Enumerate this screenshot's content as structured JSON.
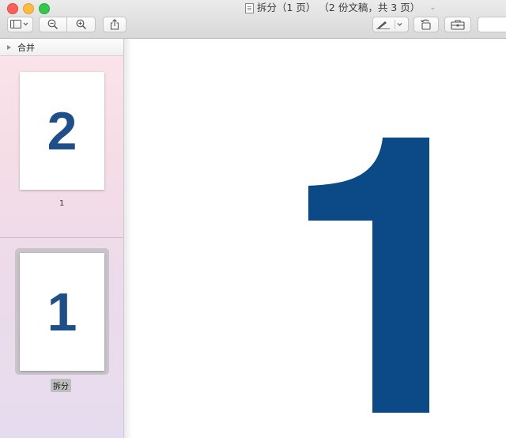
{
  "window": {
    "title": "拆分（1 页） （2 份文稿，共 3 页）",
    "title_menu_icon": "chevron-down-icon",
    "document_icon": "document-icon"
  },
  "toolbar": {
    "items": [
      {
        "name": "sidebar-toggle-button",
        "icon": "sidebar-icon"
      },
      {
        "name": "zoom-out-button",
        "icon": "zoom-out-icon"
      },
      {
        "name": "zoom-in-button",
        "icon": "zoom-in-icon"
      },
      {
        "name": "share-button",
        "icon": "share-icon"
      },
      {
        "name": "markup-pen-button",
        "icon": "pen-icon"
      },
      {
        "name": "rotate-button",
        "icon": "rotate-icon"
      },
      {
        "name": "toolbox-button",
        "icon": "toolbox-icon"
      }
    ]
  },
  "sidebar": {
    "header_label": "合并",
    "thumbnails": [
      {
        "page_number": "2",
        "label": "1",
        "selected": false
      },
      {
        "page_number": "1",
        "label": "拆分",
        "selected": true
      }
    ]
  },
  "main": {
    "page_glyph": "1"
  },
  "colors": {
    "page_glyph": "#0b4a87",
    "thumb_glyph": "#1f4f8b",
    "close": "#fc605c",
    "minimize": "#fdbc40",
    "maximize": "#34c84a"
  }
}
